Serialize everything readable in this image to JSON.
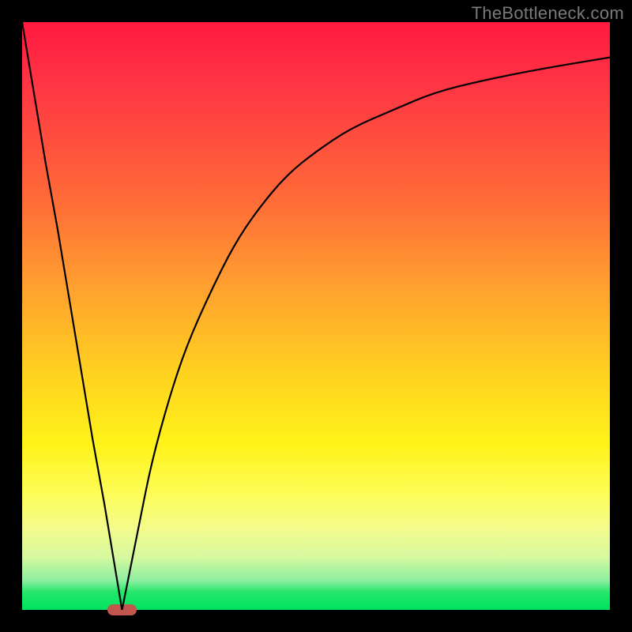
{
  "watermark": "TheBottleneck.com",
  "colors": {
    "frame": "#000000",
    "watermark": "#7a7a7a",
    "curve": "#000000",
    "marker": "#c1564e"
  },
  "chart_data": {
    "type": "line",
    "title": "",
    "xlabel": "",
    "ylabel": "",
    "xlim": [
      0,
      100
    ],
    "ylim": [
      0,
      100
    ],
    "grid": false,
    "series": [
      {
        "name": "left-branch",
        "x": [
          0,
          2,
          4,
          6,
          8,
          10,
          12,
          14,
          16,
          17
        ],
        "y": [
          100,
          88,
          76,
          65,
          53,
          41,
          29,
          18,
          6,
          0
        ]
      },
      {
        "name": "right-branch",
        "x": [
          17,
          18,
          20,
          22,
          25,
          28,
          32,
          36,
          40,
          45,
          50,
          56,
          63,
          70,
          78,
          88,
          100
        ],
        "y": [
          0,
          5,
          15,
          25,
          36,
          45,
          54,
          62,
          68,
          74,
          78,
          82,
          85,
          88,
          90,
          92,
          94
        ]
      }
    ],
    "marker": {
      "x_center": 17,
      "y": 0,
      "width_pct": 5
    }
  }
}
